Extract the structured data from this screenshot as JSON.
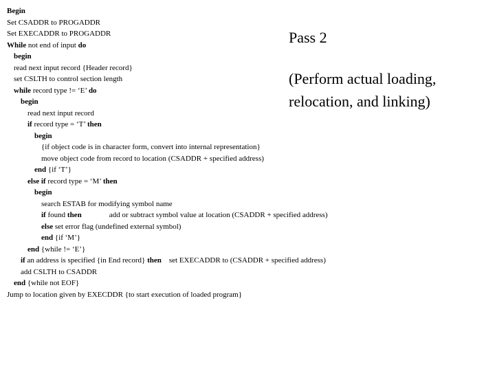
{
  "annot": {
    "title": "Pass 2",
    "desc": "(Perform actual loading, relocation, and linking)"
  },
  "kw": {
    "Begin": "Begin",
    "While": "While",
    "do": "do",
    "begin": "begin",
    "while": "while",
    "if": "if",
    "then": "then",
    "else_if": "else if",
    "else": "else",
    "end": "end"
  },
  "t": {
    "l1": "Set CSADDR to PROGADDR",
    "l2": "Set EXECADDR to PROGADDR",
    "l3": " not end of input ",
    "l5": "read next input record {Header record}",
    "l6": "set CSLTH to control section length",
    "l7a": " record type != ‘E’ ",
    "l9": "read next input record",
    "l10a": " record type = ‘T’ ",
    "l12": "{if object code is in character form, convert into internal representation}",
    "l13": "move object code from record to location (CSADDR + specified address)",
    "l14": " {if ‘T’}",
    "l15a": " record type = ‘M’ ",
    "l17": "search ESTAB for modifying symbol name",
    "l18a": " found ",
    "l18b": "add or subtract symbol value at location (CSADDR + specified address)",
    "l19": " set error flag (undefined external symbol)",
    "l20": " {if ‘M’}",
    "l21": " {while != ‘E’}",
    "l22a": " an address is specified {in End record} ",
    "l22b": "    set EXECADDR to (CSADDR + specified address)",
    "l23": "add CSLTH to CSADDR",
    "l24": " {while not EOF}",
    "l25": "Jump to location given by EXECDDR {to start execution of loaded program}"
  }
}
